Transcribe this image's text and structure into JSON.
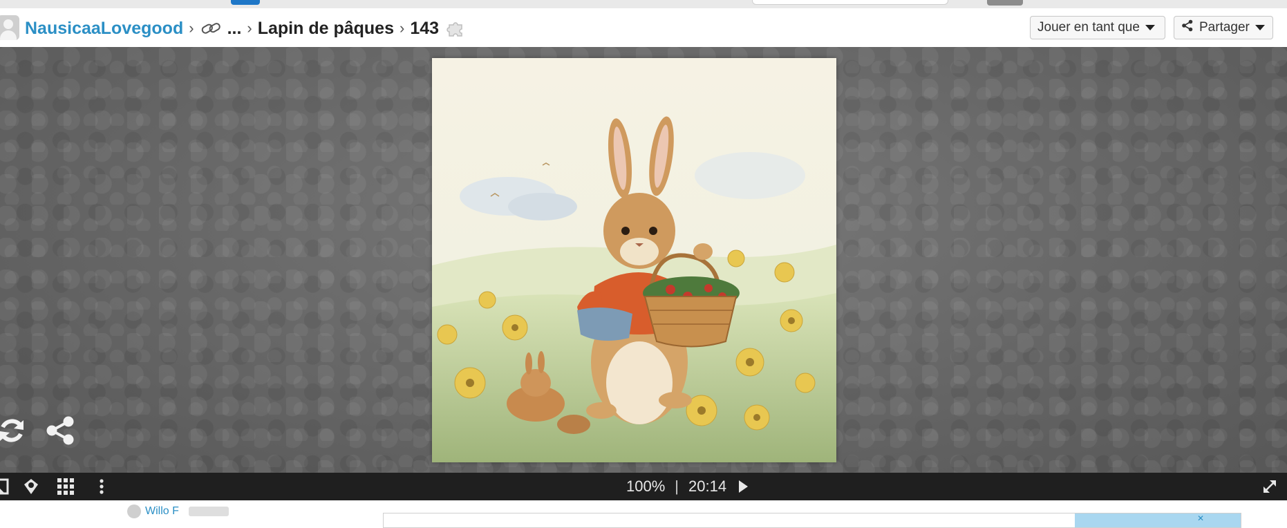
{
  "header": {
    "breadcrumb": {
      "user": "NausicaaLovegood",
      "ellipsis": "...",
      "collection": "Lapin de pâques",
      "piece_count": "143"
    },
    "play_as_label": "Jouer en tant que",
    "share_label": "Partager"
  },
  "toolbar": {
    "zoom": "100%",
    "separator": "|",
    "timer": "20:14"
  },
  "lower": {
    "commenter_name": "Willo  F"
  },
  "colors": {
    "link_blue": "#2b8fc5",
    "stage_gray": "#6a6a6a",
    "toolbar_dark": "#1f1f1f"
  },
  "icons": [
    "link-icon",
    "puzzle-icon",
    "share-icon",
    "refresh-icon",
    "share-big-icon",
    "frame-icon",
    "palette-icon",
    "grid-icon",
    "more-vertical-icon",
    "play-icon",
    "fullscreen-icon"
  ]
}
